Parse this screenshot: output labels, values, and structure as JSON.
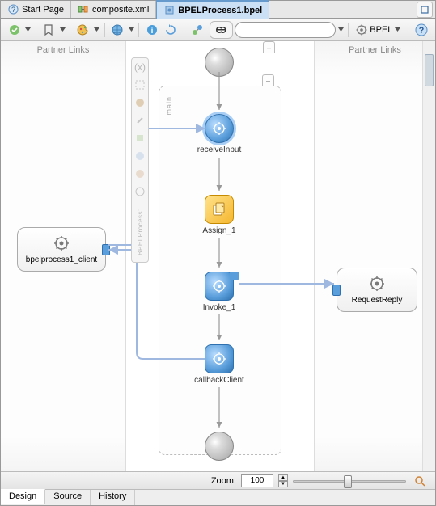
{
  "tabs": {
    "start": "Start Page",
    "composite": "composite.xml",
    "bpel": "BPELProcess1.bpel"
  },
  "toolbar": {
    "bpel_label": "BPEL"
  },
  "partner_left_header": "Partner Links",
  "partner_right_header": "Partner Links",
  "partners": {
    "client": "bpelprocess1_client",
    "request_reply": "RequestReply"
  },
  "flow": {
    "scope_label": "main",
    "nodes": {
      "receive": "receiveInput",
      "assign": "Assign_1",
      "invoke": "Invoke_1",
      "callback": "callbackClient"
    },
    "palette_label": "BPELProcess1"
  },
  "zoom": {
    "label": "Zoom:",
    "value": "100"
  },
  "bottom_tabs": {
    "design": "Design",
    "source": "Source",
    "history": "History"
  }
}
